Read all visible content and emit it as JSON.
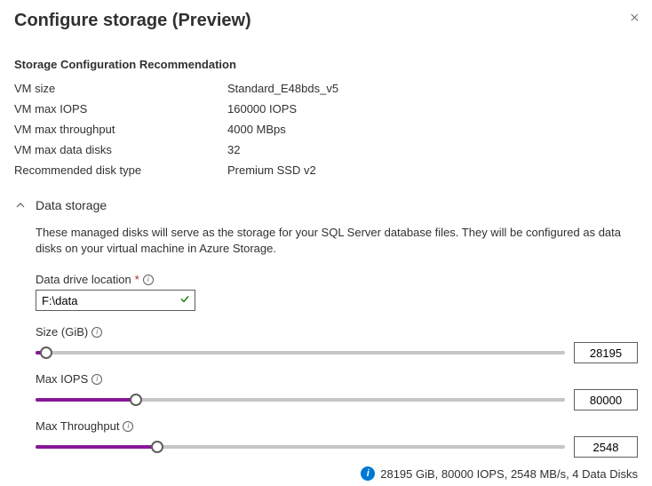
{
  "header": {
    "title": "Configure storage (Preview)"
  },
  "recommendation": {
    "heading": "Storage Configuration Recommendation",
    "vm_size_label": "VM size",
    "vm_size_value": "Standard_E48bds_v5",
    "vm_max_iops_label": "VM max IOPS",
    "vm_max_iops_value": "160000 IOPS",
    "vm_max_throughput_label": "VM max throughput",
    "vm_max_throughput_value": "4000 MBps",
    "vm_max_disks_label": "VM max data disks",
    "vm_max_disks_value": "32",
    "recommended_disk_label": "Recommended disk type",
    "recommended_disk_value": "Premium SSD v2"
  },
  "data_storage": {
    "title": "Data storage",
    "description": "These managed disks will serve as the storage for your SQL Server database files. They will be configured as data disks on your virtual machine in Azure Storage.",
    "drive_location_label": "Data drive location",
    "drive_location_value": "F:\\data",
    "size_label": "Size (GiB)",
    "size_value": "28195",
    "max_iops_label": "Max IOPS",
    "max_iops_value": "80000",
    "max_throughput_label": "Max Throughput",
    "max_throughput_value": "2548",
    "summary": "28195 GiB, 80000 IOPS, 2548 MB/s, 4 Data Disks"
  },
  "slider_positions": {
    "size_pct": 2,
    "iops_pct": 19,
    "throughput_pct": 23
  }
}
